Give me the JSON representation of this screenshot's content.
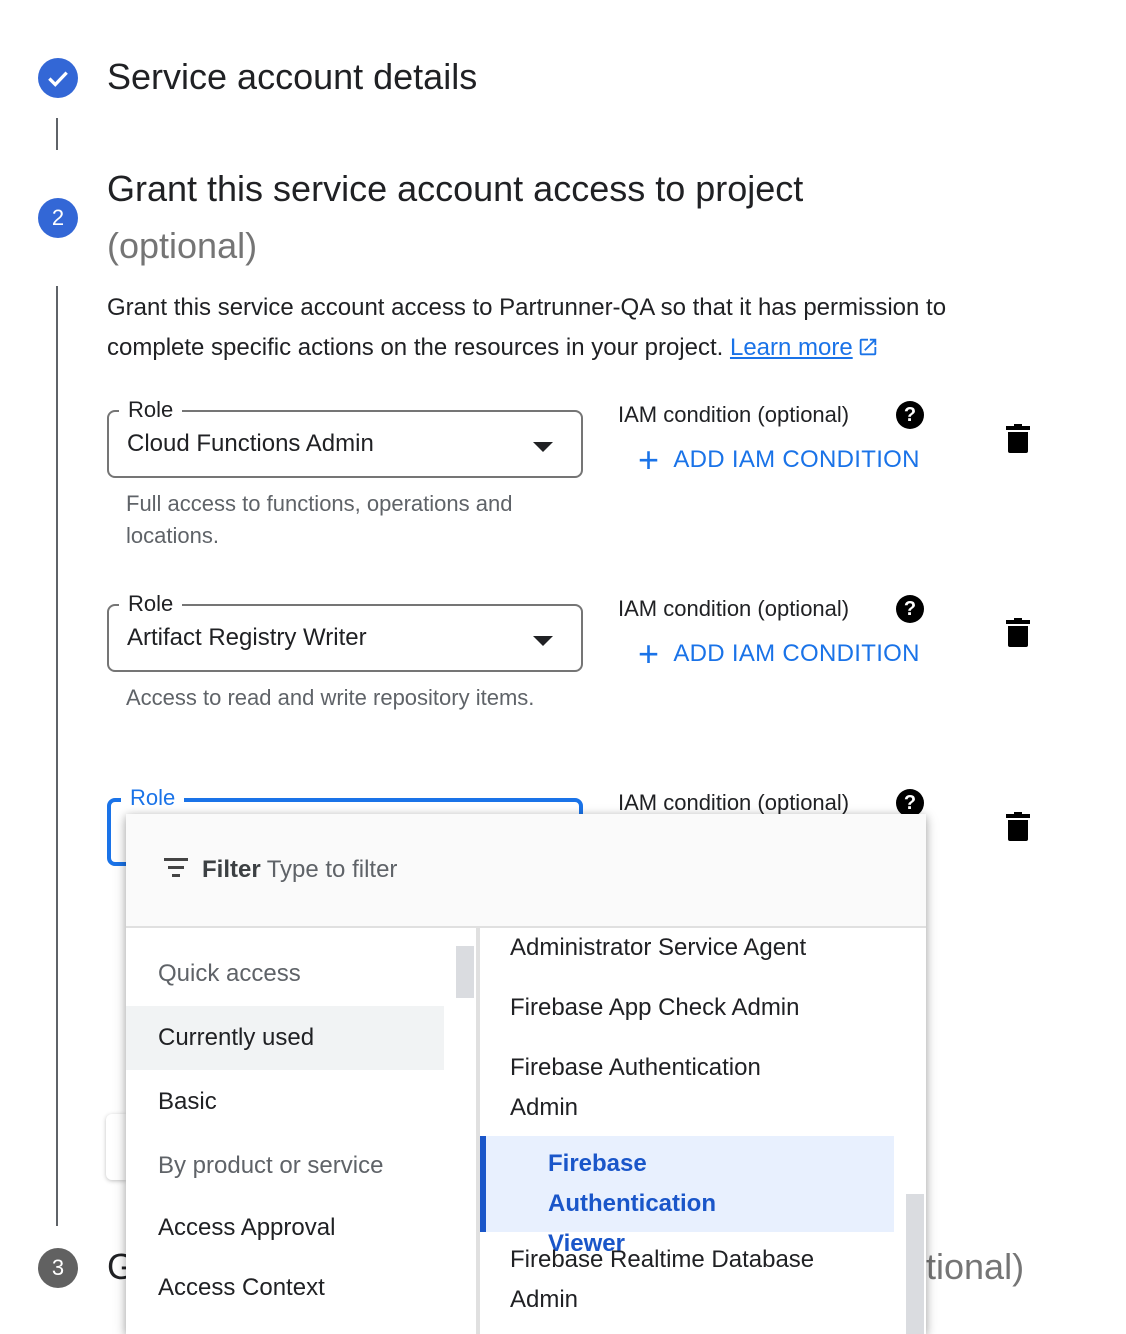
{
  "steps": [
    {
      "number": "",
      "title": "Service account details",
      "state": "complete"
    },
    {
      "number": "2",
      "title": "Grant this service account access to project",
      "optional": "(optional)",
      "state": "active"
    },
    {
      "number": "3",
      "title_visible_start": "G",
      "title_visible_end": "tional)",
      "state": "pending"
    }
  ],
  "description": {
    "text": "Grant this service account access to Partrunner-QA so that it has permission to complete specific actions on the resources in your project. ",
    "learn_more": "Learn more"
  },
  "roles": [
    {
      "legend": "Role",
      "value": "Cloud Functions Admin",
      "hint": "Full access to functions, operations and locations.",
      "iam_label": "IAM condition (optional)",
      "help": "?",
      "add_condition": "ADD IAM CONDITION"
    },
    {
      "legend": "Role",
      "value": "Artifact Registry Writer",
      "hint": "Access to read and write repository items.",
      "iam_label": "IAM condition (optional)",
      "help": "?",
      "add_condition": "ADD IAM CONDITION"
    },
    {
      "legend": "Role",
      "value": "",
      "iam_label": "IAM condition (optional)",
      "help": "?"
    }
  ],
  "dropdown": {
    "filter_label": "Filter",
    "filter_placeholder": "Type to filter",
    "categories": [
      {
        "label": "Quick access",
        "type": "header"
      },
      {
        "label": "Currently used",
        "type": "item",
        "selected": true
      },
      {
        "label": "Basic",
        "type": "item"
      },
      {
        "label": "By product or service",
        "type": "header"
      },
      {
        "label": "Access Approval",
        "type": "item"
      },
      {
        "label": "Access Context",
        "type": "item"
      }
    ],
    "role_options": [
      {
        "label": "Administrator Service Agent"
      },
      {
        "label": "Firebase App Check Admin"
      },
      {
        "label": "Firebase Authentication Admin"
      },
      {
        "label": "Firebase Authentication Viewer",
        "selected": true
      },
      {
        "label": "Firebase Realtime Database Admin"
      }
    ]
  },
  "colors": {
    "accent": "#1a73e8",
    "step_complete": "#3367d6",
    "step_pending": "#616161",
    "selected_role_text": "#1a56c9",
    "selected_role_bg": "#e8f0fe"
  },
  "icons": [
    "check-icon",
    "external-link-icon",
    "dropdown-caret-icon",
    "help-icon",
    "add-icon",
    "delete-icon",
    "filter-icon"
  ]
}
